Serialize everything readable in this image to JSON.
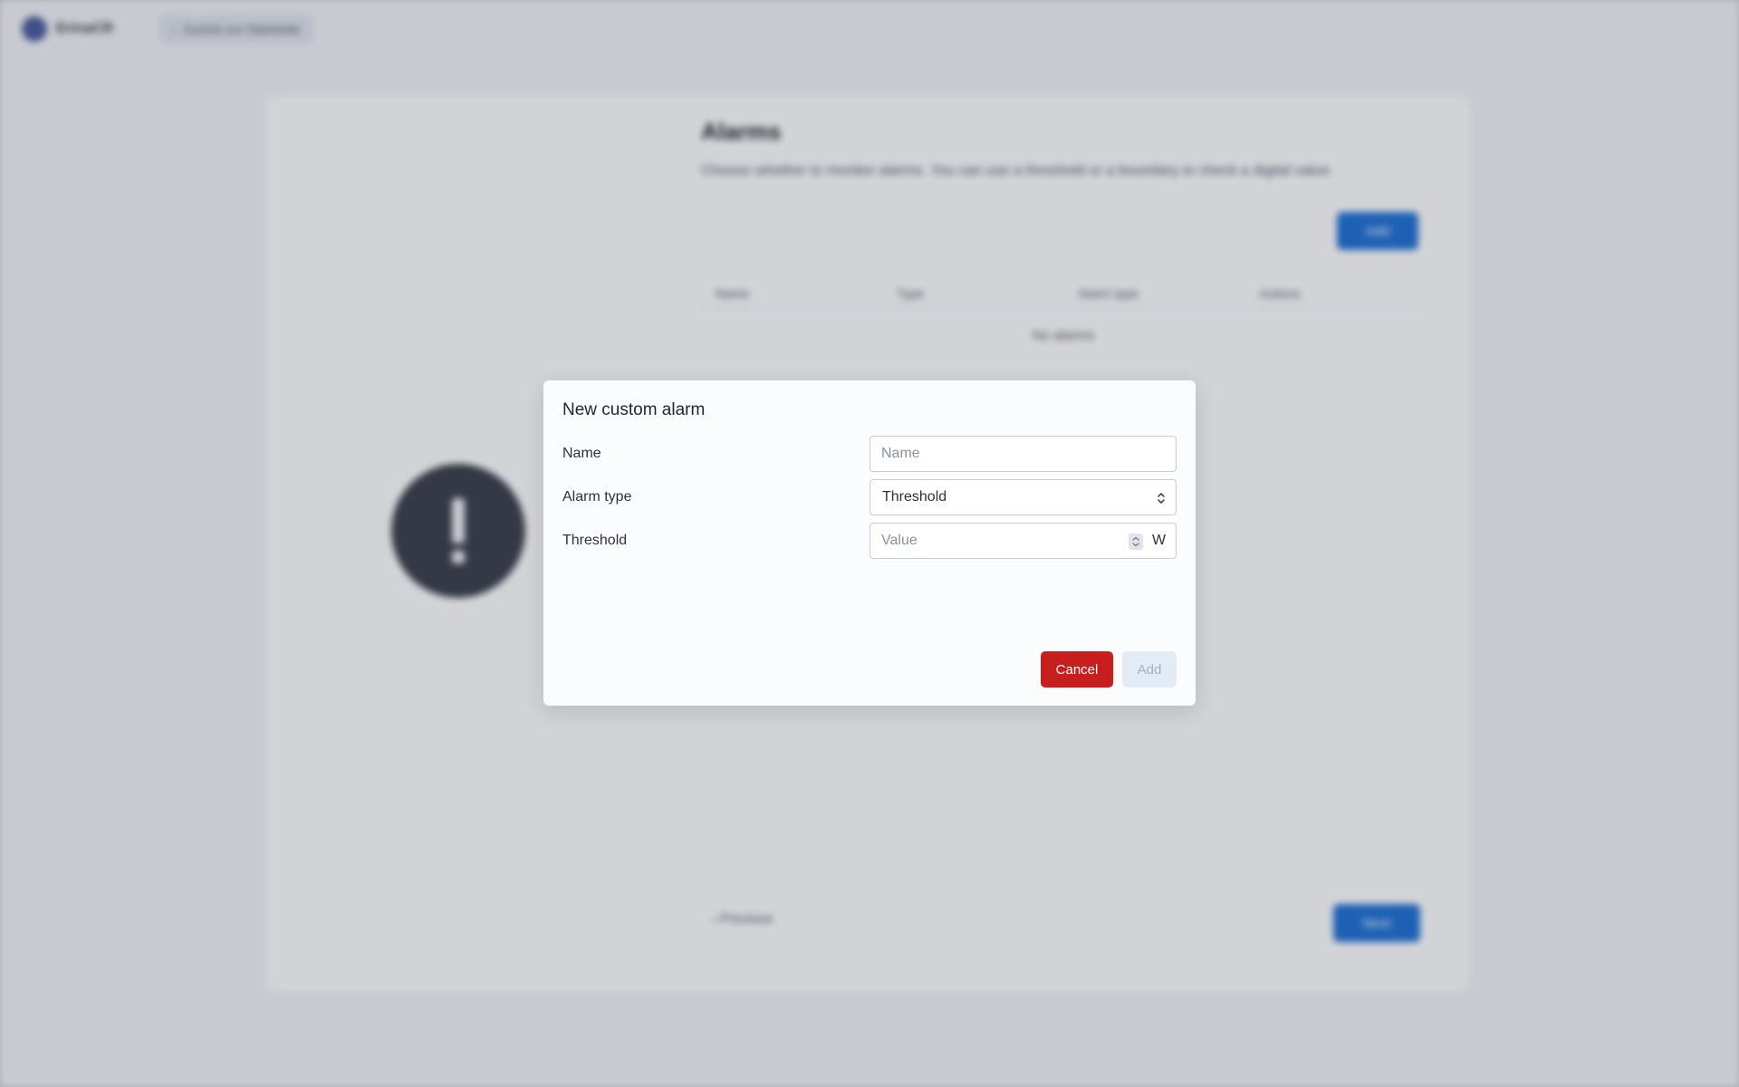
{
  "background": {
    "app_name": "ErinaCR",
    "back_link": "Zurück zur Startseite",
    "page_title": "Alarms",
    "page_description": "Choose whether to monitor alarms. You can use a threshold or a boundary to check a digital value.",
    "add_button": "Add",
    "table_headers": [
      "Name",
      "Type",
      "Alarm type",
      "Actions"
    ],
    "empty_text": "No alarms",
    "previous_label": "Previous",
    "next_label": "Next"
  },
  "modal": {
    "title": "New custom alarm",
    "name_label": "Name",
    "name_placeholder": "Name",
    "alarm_type_label": "Alarm type",
    "alarm_type_value": "Threshold",
    "threshold_label": "Threshold",
    "threshold_placeholder": "Value",
    "threshold_unit": "W",
    "cancel_label": "Cancel",
    "add_label": "Add"
  },
  "colors": {
    "cancel": "#c81e1e",
    "add_disabled": "#e3ebf7",
    "primary": "#1f6fd1"
  },
  "icons": {
    "alarm_illustration": "exclamation-circle-icon",
    "select_indicator": "chevron-up-down-icon",
    "number_spinner": "spinner-icon"
  }
}
